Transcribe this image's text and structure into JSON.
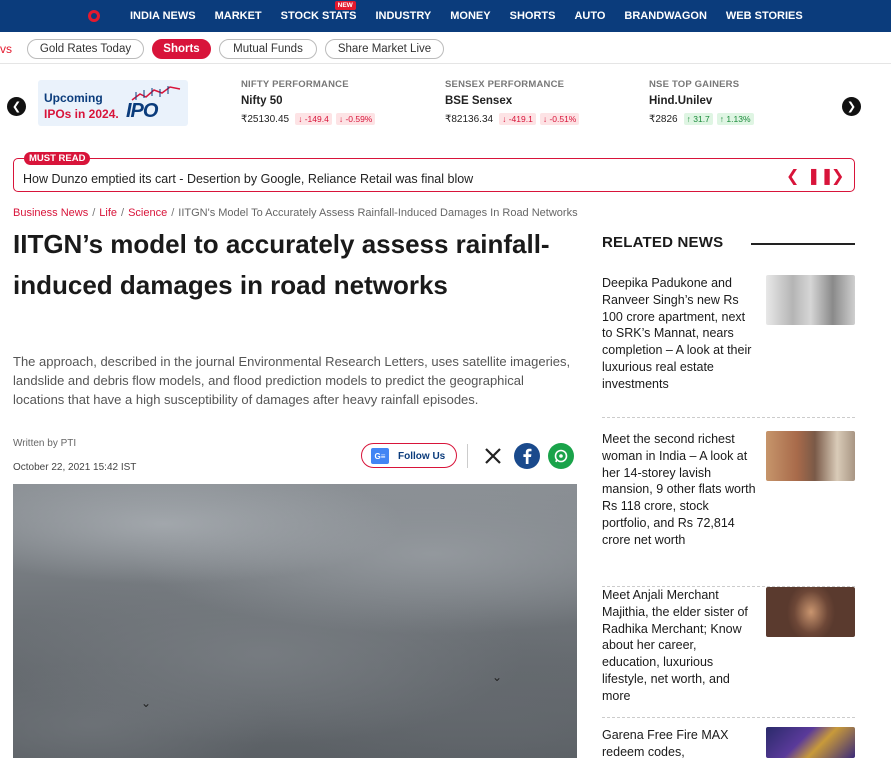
{
  "nav": {
    "items": [
      "INDIA NEWS",
      "MARKET",
      "STOCK STATS",
      "INDUSTRY",
      "MONEY",
      "SHORTS",
      "AUTO",
      "BRANDWAGON",
      "WEB STORIES"
    ],
    "new_badge": "NEW"
  },
  "chips": {
    "cutoff": "vs",
    "items": [
      "Gold Rates Today",
      "Shorts",
      "Mutual Funds",
      "Share Market Live"
    ]
  },
  "ipo_banner": {
    "line1": "Upcoming",
    "line2": "IPOs in 2024.",
    "logo": "IPO"
  },
  "markets": [
    {
      "heading": "NIFTY PERFORMANCE",
      "name": "Nifty 50",
      "price": "₹25130.45",
      "change": "-149.4",
      "pct": "-0.59%",
      "direction": "down"
    },
    {
      "heading": "SENSEX PERFORMANCE",
      "name": "BSE Sensex",
      "price": "₹82136.34",
      "change": "-419.1",
      "pct": "-0.51%",
      "direction": "down"
    },
    {
      "heading": "NSE TOP GAINERS",
      "name": "Hind.Unilev",
      "price": "₹2826",
      "change": "31.7",
      "pct": "1.13%",
      "direction": "up"
    }
  ],
  "must_read": {
    "tag": "MUST READ",
    "headline": "How Dunzo emptied its cart - Desertion by Google, Reliance Retail was final blow"
  },
  "breadcrumb": [
    "Business News",
    "Life",
    "Science",
    "IITGN's Model To Accurately Assess Rainfall-Induced Damages In Road Networks"
  ],
  "article": {
    "title": "IITGN’s model to accurately assess rainfall-induced damages in road networks",
    "summary": "The approach, described in the journal Environmental Research Letters, uses satellite imageries, landslide and debris flow models, and flood prediction models to predict the geographical locations that have a high susceptibility of damages after heavy rainfall episodes.",
    "byline": "Written by PTI",
    "date": "October 22, 2021 15:42 IST",
    "follow_label": "Follow Us"
  },
  "related": {
    "heading": "RELATED NEWS",
    "items": [
      "Deepika Padukone and Ranveer Singh’s new Rs 100 crore apartment, next to SRK’s Mannat, nears completion – A look at their luxurious real estate investments",
      "Meet the second richest woman in India – A look at her 14-storey lavish mansion, 9 other flats worth Rs 118 crore, stock portfolio, and Rs 72,814 crore net worth",
      "Meet Anjali Merchant Majithia, the elder sister of Radhika Merchant; Know about her career, education, luxurious lifestyle, net worth, and more",
      "Garena Free Fire MAX redeem codes,"
    ]
  },
  "colors": {
    "nav_bg": "#0b3c7c",
    "accent_red": "#d8143a",
    "gain_green": "#1a8b3a"
  }
}
